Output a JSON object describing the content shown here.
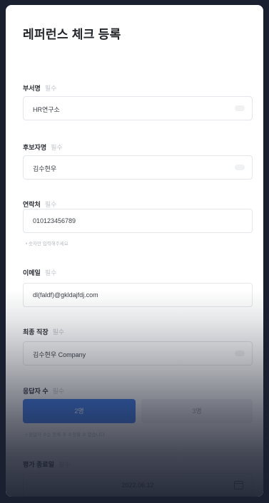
{
  "form": {
    "title": "레퍼런스 체크 등록",
    "required_tag": "필수",
    "fields": {
      "department": {
        "label": "부서명",
        "value": "HR연구소"
      },
      "candidate": {
        "label": "후보자명",
        "value": "김수현우"
      },
      "phone": {
        "label": "연락처",
        "value": "010123456789",
        "hint": "• 숫자만 입력해주세요"
      },
      "email": {
        "label": "이메일",
        "value": "dl(faldf)@gkldajfdj.com"
      },
      "last_job": {
        "label": "최종 직장",
        "value": "김수현우 Company"
      },
      "respondents": {
        "label": "응답자 수",
        "options": [
          "2명",
          "3명"
        ],
        "selected": "2명",
        "hint": "• 응답자 수는 등록 후 수정할 수 없습니다"
      },
      "end_date": {
        "label": "평가 종료일",
        "value": "2022.06.12"
      }
    }
  },
  "colors": {
    "accent": "#3b7cf0",
    "backdrop": "#1b2030"
  },
  "icons": {
    "calendar": "calendar-icon"
  }
}
